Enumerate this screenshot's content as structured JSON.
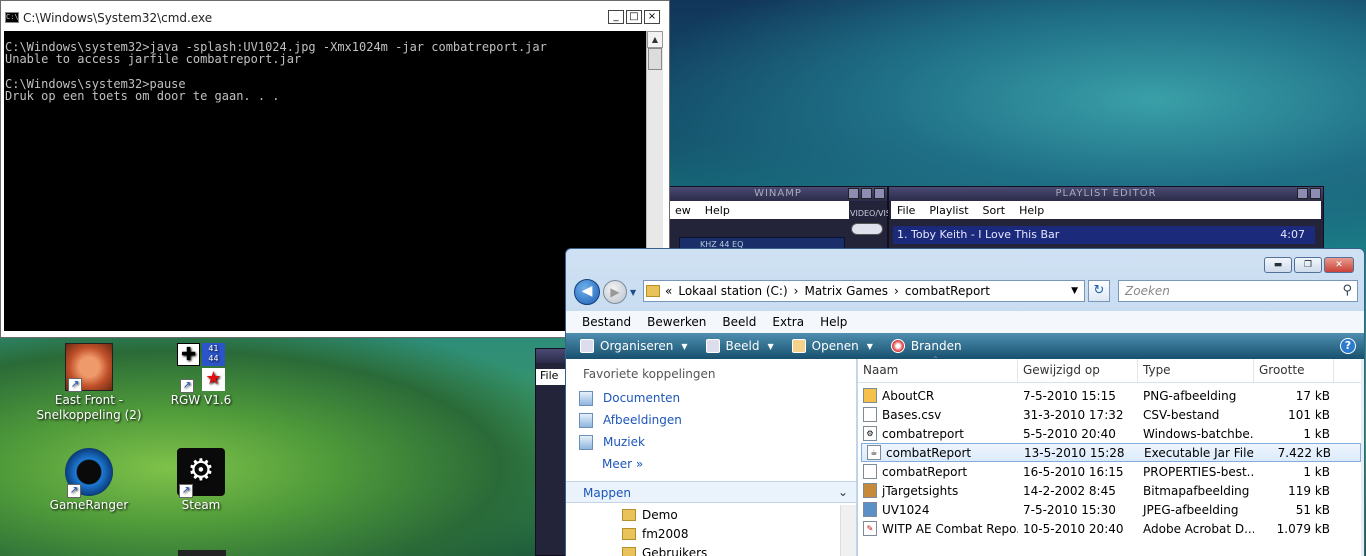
{
  "cmd": {
    "title": "C:\\Windows\\System32\\cmd.exe",
    "lines": "C:\\Windows\\system32>java -splash:UV1024.jpg -Xmx1024m -jar combatreport.jar\nUnable to access jarfile combatreport.jar\n\nC:\\Windows\\system32>pause\nDruk op een toets om door te gaan. . ."
  },
  "desktop_icons": [
    {
      "label": "East Front -\nSnelkoppeling (2)",
      "icon": "east-front-icon"
    },
    {
      "label": "RGW V1.6",
      "icon": "rgw-icon",
      "badge1": "41",
      "badge2": "44"
    },
    {
      "label": "GameRanger",
      "icon": "gameranger-icon"
    },
    {
      "label": "Steam",
      "icon": "steam-icon"
    }
  ],
  "winamp": {
    "main_title": "WINAMP",
    "main_menu": [
      "ew",
      "Help"
    ],
    "main_button": "VIDEO/VIS",
    "main_display": "KHZ 44 EQ",
    "playlist_title": "PLAYLIST EDITOR",
    "playlist_menu": [
      "File",
      "Playlist",
      "Sort",
      "Help"
    ],
    "track": "1. Toby Keith - I Love This Bar",
    "track_time": "4:07",
    "second_menu": "File"
  },
  "explorer": {
    "address": [
      "«",
      "Lokaal station (C:)",
      "›",
      "Matrix Games",
      "›",
      "combatReport"
    ],
    "search_placeholder": "Zoeken",
    "menu": [
      "Bestand",
      "Bewerken",
      "Beeld",
      "Extra",
      "Help"
    ],
    "toolbar": [
      {
        "label": "Organiseren",
        "icon": "organize-icon"
      },
      {
        "label": "Beeld",
        "icon": "view-icon"
      },
      {
        "label": "Openen",
        "icon": "open-icon"
      },
      {
        "label": "Branden",
        "icon": "burn-icon"
      }
    ],
    "favorites_header": "Favoriete koppelingen",
    "favorites": [
      "Documenten",
      "Afbeeldingen",
      "Muziek"
    ],
    "more": "Meer",
    "more_arrow": "»",
    "folders_header": "Mappen",
    "tree": [
      "Demo",
      "fm2008",
      "Gebruikers"
    ],
    "columns": [
      "Naam",
      "Gewijzigd op",
      "Type",
      "Grootte"
    ],
    "files": [
      {
        "name": "AboutCR",
        "date": "7-5-2010 15:15",
        "type": "PNG-afbeelding",
        "size": "17 kB",
        "icon": "png-icon"
      },
      {
        "name": "Bases.csv",
        "date": "31-3-2010 17:32",
        "type": "CSV-bestand",
        "size": "101 kB",
        "icon": "csv-icon"
      },
      {
        "name": "combatreport",
        "date": "5-5-2010 20:40",
        "type": "Windows-batchbe...",
        "size": "1 kB",
        "icon": "batch-icon"
      },
      {
        "name": "combatReport",
        "date": "13-5-2010 15:28",
        "type": "Executable Jar File",
        "size": "7.422 kB",
        "icon": "jar-icon"
      },
      {
        "name": "combatReport",
        "date": "16-5-2010 16:15",
        "type": "PROPERTIES-best...",
        "size": "1 kB",
        "icon": "properties-icon"
      },
      {
        "name": "jTargetsights",
        "date": "14-2-2002 8:45",
        "type": "Bitmapafbeelding",
        "size": "119 kB",
        "icon": "bitmap-icon"
      },
      {
        "name": "UV1024",
        "date": "7-5-2010 15:30",
        "type": "JPEG-afbeelding",
        "size": "51 kB",
        "icon": "jpeg-icon"
      },
      {
        "name": "WITP AE Combat Repo...",
        "date": "10-5-2010 20:40",
        "type": "Adobe Acrobat D...",
        "size": "1.079 kB",
        "icon": "pdf-icon"
      }
    ]
  }
}
